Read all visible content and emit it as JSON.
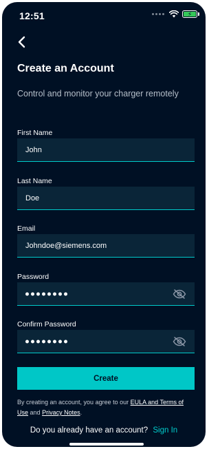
{
  "status_bar": {
    "time": "12:51",
    "battery_color": "#35c759"
  },
  "header": {
    "back_icon": "chevron-left-icon",
    "title": "Create an Account",
    "subtitle": "Control and monitor your charger remotely"
  },
  "form": {
    "first_name": {
      "label": "First Name",
      "value": "John"
    },
    "last_name": {
      "label": "Last Name",
      "value": "Doe"
    },
    "email": {
      "label": "Email",
      "value": "Johndoe@siemens.com"
    },
    "password": {
      "label": "Password",
      "masked_length": 8,
      "toggle_icon": "eye-off-icon"
    },
    "confirm_password": {
      "label": "Confirm Password",
      "masked_length": 8,
      "toggle_icon": "eye-off-icon"
    }
  },
  "create_button": {
    "label": "Create"
  },
  "legal": {
    "prefix": "By creating an account, you agree to our",
    "eula_link": "EULA and Terms of Use",
    "and": "and",
    "privacy_link": "Privacy Notes",
    "suffix": "."
  },
  "signin": {
    "prompt": "Do you already have an account?",
    "link": "Sign In"
  },
  "colors": {
    "background": "#001024",
    "field_bg": "#0a2538",
    "accent": "#00cccc",
    "button": "#00c7c7"
  }
}
